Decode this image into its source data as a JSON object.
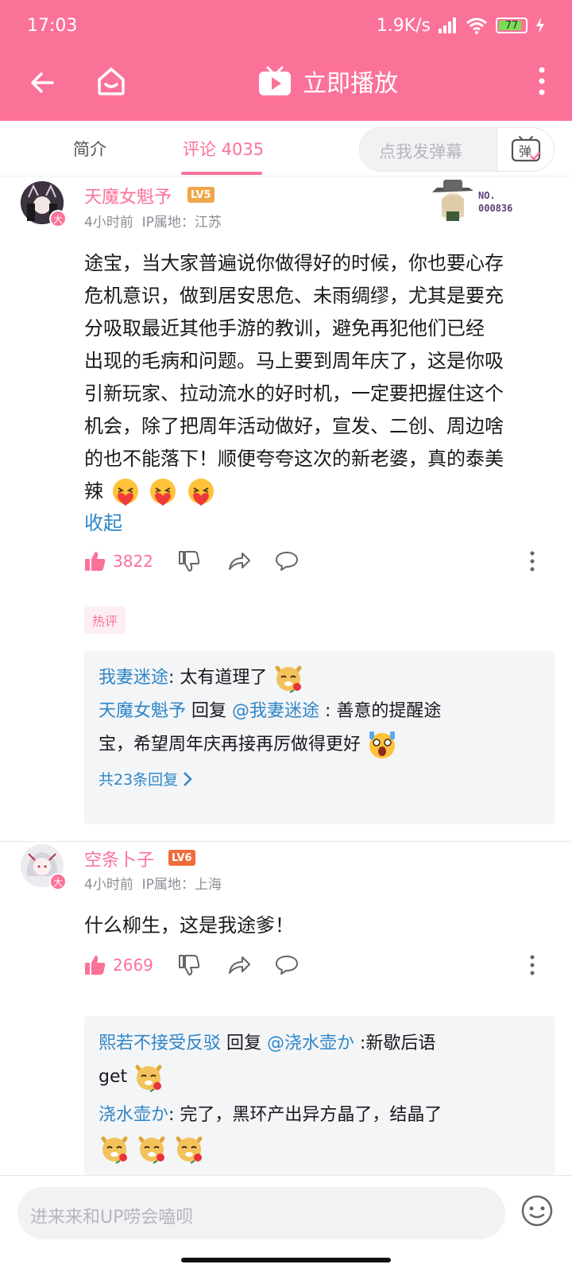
{
  "status_bar": {
    "time": "17:03",
    "network_speed": "1.9K/s",
    "battery": "77"
  },
  "top_bar": {
    "play_label": "立即播放"
  },
  "tabs": {
    "intro": "简介",
    "comments": "评论 4035"
  },
  "danmaku": {
    "placeholder": "点我发弹幕",
    "button": "弹"
  },
  "comments": [
    {
      "username": "天魔女魁予",
      "level": "LV5",
      "avatar_badge": "大",
      "time": "4小时前",
      "ip": "IP属地：江苏",
      "sticker_text": "NO. 000836",
      "text_lines": [
        "途宝，当大家普遍说你做得好的时候，你也要心存",
        "危机意识，做到居安思危、未雨绸缪，尤其是要充",
        "分吸取最近其他手游的教训，避免再犯他们已经",
        "出现的毛病和问题。马上要到周年庆了，这是你吸",
        "引新玩家、拉动流水的好时机，一定要把握住这个",
        "机会，除了把周年活动做好，宣发、二创、周边啥",
        "的也不能落下！顺便夸夸这次的新老婆，真的泰美",
        "辣"
      ],
      "collapse_label": "收起",
      "likes": "3822",
      "hot_label": "热评",
      "replies": [
        {
          "user": "我妻迷途",
          "text": ": 太有道理了"
        },
        {
          "user": "天魔女魁予",
          "reply_word": " 回复 ",
          "mention": "@我妻迷途",
          "text_line1": " : 善意的提醒途",
          "text_line2": "宝，希望周年庆再接再厉做得更好"
        }
      ],
      "more_replies": "共23条回复"
    },
    {
      "username": "空条卜子",
      "level": "LV6",
      "avatar_badge": "大",
      "time": "4小时前",
      "ip": "IP属地：上海",
      "text": "什么柳生，这是我途爹！",
      "likes": "2669",
      "replies": [
        {
          "user": "熙若不接受反驳",
          "reply_word": " 回复 ",
          "mention": "@浇水壶か",
          "text_line1": " :新歇后语",
          "text_line2": "get"
        },
        {
          "user": "浇水壶か",
          "text": ": 完了，黑环产出异方晶了，结晶了"
        }
      ]
    }
  ],
  "input_bar": {
    "placeholder": "进来来和UP唠会嗑呗"
  },
  "colors": {
    "brand_pink": "#fb7299",
    "link_blue": "#2f86c7",
    "lv5": "#f0a64a",
    "lv6": "#f26b3a"
  }
}
